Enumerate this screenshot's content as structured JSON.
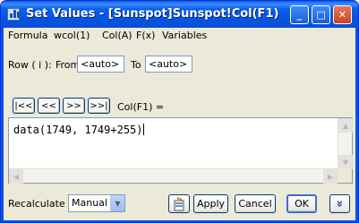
{
  "window": {
    "title": "Set Values - [Sunspot]Sunspot!Col(F1)",
    "controls": {
      "minimize": "_",
      "maximize": "□",
      "close": "✕"
    }
  },
  "menubar": [
    "Formula",
    "wcol(1)",
    "Col(A)",
    "F(x)",
    "Variables"
  ],
  "row_range": {
    "label": "Row ( i ):",
    "from_label": "From",
    "from_value": "<auto>",
    "to_label": "To",
    "to_value": "<auto>"
  },
  "nav": {
    "first": "|<<",
    "prev": "<<",
    "next": ">>",
    "last": ">>|",
    "column_label": "Col(F1) ="
  },
  "formula": "data(1749, 1749+255)",
  "footer": {
    "recalculate_label": "Recalculate",
    "recalculate_value": "Manual",
    "apply": "Apply",
    "cancel": "Cancel",
    "ok": "OK",
    "expand": "»"
  },
  "colors": {
    "title_bar": "#0a5fe9",
    "dialog_bg": "#ece9d8",
    "field_border": "#7f9db9"
  }
}
